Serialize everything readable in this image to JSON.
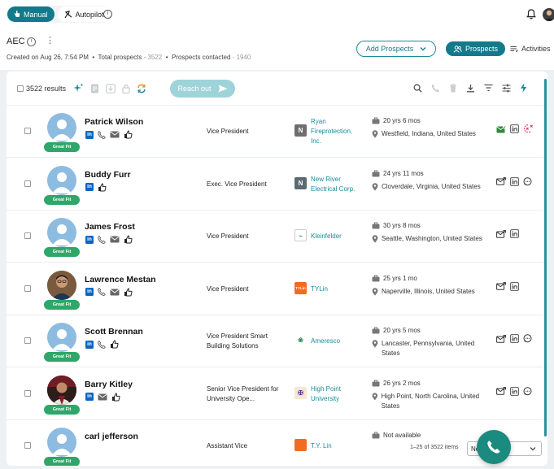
{
  "topbar": {
    "mode_manual": "Manual",
    "mode_autopilot": "Autopilot"
  },
  "header": {
    "list_name": "AEC",
    "created_label": "Created on",
    "created_on": "Aug 26, 7:54 PM",
    "total_label": "Total prospects",
    "total_value": "3522",
    "contacted_label": "Prospects contacted",
    "contacted_value": "1940",
    "add_prospects": "Add Prospects",
    "tab_prospects": "Prospects",
    "tab_activities": "Activities"
  },
  "toolbar": {
    "results": "3522 results",
    "reach_out": "Reach out"
  },
  "fit_label": "Great Fit",
  "rows": [
    {
      "name": "Patrick Wilson",
      "title": "Vice President",
      "company": "Ryan Fireprotection, Inc.",
      "logo": "N",
      "tenure": "20 yrs 6 mos",
      "location": "Westfield, Indiana, United States"
    },
    {
      "name": "Buddy Furr",
      "title": "Exec. Vice President",
      "company": "New River Electrical Corp.",
      "logo": "N",
      "tenure": "24 yrs 11 mos",
      "location": "Cloverdale, Virginia, United States"
    },
    {
      "name": "James Frost",
      "title": "Vice President",
      "company": "Kleinfelder",
      "logo": "",
      "tenure": "30 yrs 8 mos",
      "location": "Seattle, Washington, United States"
    },
    {
      "name": "Lawrence Mestan",
      "title": "Vice President",
      "company": "TYLin",
      "logo": "TYLin",
      "tenure": "25 yrs 1 mo",
      "location": "Naperville, Illinois, United States"
    },
    {
      "name": "Scott Brennan",
      "title": "Vice President Smart Building Solutions",
      "company": "Ameresco",
      "logo": "",
      "tenure": "20 yrs 5 mos",
      "location": "Lancaster, Pennsylvania, United States"
    },
    {
      "name": "Barry Kitley",
      "title": "Senior Vice President for University Ope...",
      "company": "High Point University",
      "logo": "",
      "tenure": "26 yrs 2 mos",
      "location": "High Point, North Carolina, United States"
    },
    {
      "name": "carl jefferson",
      "title": "Assistant Vice",
      "company": "T.Y. Lin",
      "logo": "",
      "tenure": "Not available",
      "location": ""
    }
  ],
  "footer": {
    "range": "1–25 of 3522 items",
    "page_select": "Next page"
  },
  "colors": {
    "brand": "#127a8a",
    "fit_green": "#2ea769",
    "linkedin": "#0a66c2"
  }
}
